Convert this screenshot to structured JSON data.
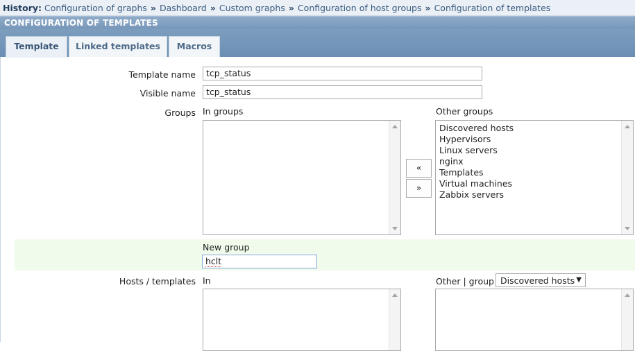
{
  "history": {
    "label": "History:",
    "crumbs": [
      "Configuration of graphs",
      "Dashboard",
      "Custom graphs",
      "Configuration of host groups",
      "Configuration of templates"
    ],
    "separator": "»"
  },
  "section": {
    "title": "CONFIGURATION OF TEMPLATES"
  },
  "tabs": [
    {
      "label": "Template",
      "active": true
    },
    {
      "label": "Linked templates",
      "active": false
    },
    {
      "label": "Macros",
      "active": false
    }
  ],
  "form": {
    "template_name": {
      "label": "Template name",
      "value": "tcp_status"
    },
    "visible_name": {
      "label": "Visible name",
      "value": "tcp_status"
    },
    "groups": {
      "label": "Groups",
      "in_groups_label": "In groups",
      "in_groups": [],
      "other_groups_label": "Other groups",
      "other_groups": [
        "Discovered hosts",
        "Hypervisors",
        "Linux servers",
        "nginx",
        "Templates",
        "Virtual machines",
        "Zabbix servers"
      ],
      "add_button": "«",
      "remove_button": "»"
    },
    "new_group": {
      "label": "New group",
      "value": "hclt"
    },
    "hosts_templates": {
      "label": "Hosts / templates",
      "in_label": "In",
      "other_label": "Other | group",
      "group_select": "Discovered hosts"
    }
  },
  "colors": {
    "header_bg": "#7d9dbe",
    "new_group_bg": "#f0fbec",
    "link": "#3d5c80"
  }
}
